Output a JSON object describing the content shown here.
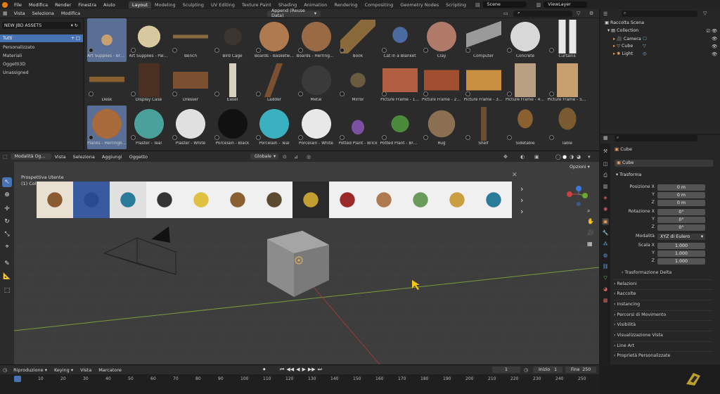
{
  "topbar": {
    "menus": [
      "File",
      "Modifica",
      "Render",
      "Finestra",
      "Aiuto"
    ],
    "workspaces": [
      "Layout",
      "Modeling",
      "Sculpting",
      "UV Editing",
      "Texture Paint",
      "Shading",
      "Animation",
      "Rendering",
      "Compositing",
      "Geometry Nodes",
      "Scripting"
    ],
    "active_workspace": "Layout",
    "scene": "Scene",
    "view_layer": "ViewLayer"
  },
  "asset_browser": {
    "menus": [
      "Vista",
      "Seleziona",
      "Modifica"
    ],
    "import_mode": "Append (Reuse Data)",
    "library": "NEW JBD ASSETS",
    "categories": [
      "Tutti",
      "Personalizzato",
      "Materiali",
      "Oggetti3D",
      "Unassigned"
    ],
    "active_category": "Tutti",
    "assets": [
      "Art Supplies - Brus...",
      "Art Supplies - Palett",
      "Bench",
      "Bird Cage",
      "Boards - Basketwe...",
      "Boards - Herringbo...",
      "Book",
      "Cat in a Blanket",
      "Clay",
      "Computer",
      "Concrete",
      "Curtains",
      "Desk",
      "Display Case",
      "Dresser",
      "Easel",
      "Ladder",
      "Metal",
      "Mirror",
      "Picture Frame - 1...",
      "Picture Frame - 2 ...",
      "Picture Frame - 3 ...",
      "Picture Frame - 4 S...",
      "Picture Frame - 5 F...",
      "Planks - Herringbon",
      "Plaster - Teal",
      "Plaster - White",
      "Porcelain - Black",
      "Porcelain - Teal",
      "Porcelain - White",
      "Potted Plant - Brick",
      "Potted Plant - Brac...",
      "Rug",
      "Shelf",
      "Sidetable",
      "Table"
    ]
  },
  "viewport": {
    "mode": "Modalità Og...",
    "menus": [
      "Vista",
      "Seleziona",
      "Aggiungi",
      "Oggetto"
    ],
    "orientation": "Globale",
    "overlay_title": "Prospettiva Utente",
    "overlay_sub": "(1) Colle",
    "options": "Opzioni"
  },
  "outliner": {
    "title": "Raccolta Scena",
    "items": [
      {
        "name": "Collection",
        "icon": "collection-icon"
      },
      {
        "name": "Camera",
        "icon": "camera-icon"
      },
      {
        "name": "Cube",
        "icon": "mesh-icon"
      },
      {
        "name": "Light",
        "icon": "light-icon"
      }
    ]
  },
  "properties": {
    "object_name": "Cube",
    "data_name": "Cube",
    "section_transform": "Trasforma",
    "location_label": "Posizione X",
    "location": [
      "0 m",
      "0 m",
      "0 m"
    ],
    "rotation_label": "Rotazione X",
    "rotation": [
      "0°",
      "0°",
      "0°"
    ],
    "mode_label": "Modalità",
    "mode_value": "XYZ di Eulero",
    "scale_label": "Scala X",
    "scale": [
      "1.000",
      "1.000",
      "1.000"
    ],
    "axis_y": "Y",
    "axis_z": "Z",
    "delta": "Trasformazione Delta",
    "sections": [
      "Relazioni",
      "Raccolte",
      "Instancing",
      "Percorsi di Movimento",
      "Visibilità",
      "Visualizzazione Vista",
      "Line Art",
      "Proprietà Personalizzate"
    ]
  },
  "timeline": {
    "menus": [
      "Riproduzione",
      "Keying",
      "Vista",
      "Marcatore"
    ],
    "current": "1",
    "start_label": "Inizio",
    "start": "1",
    "end_label": "Fine",
    "end": "250",
    "ticks": [
      "1",
      "10",
      "20",
      "30",
      "40",
      "50",
      "60",
      "70",
      "80",
      "90",
      "100",
      "110",
      "120",
      "130",
      "140",
      "150",
      "160",
      "170",
      "180",
      "190",
      "200",
      "210",
      "220",
      "230",
      "240",
      "250"
    ]
  }
}
